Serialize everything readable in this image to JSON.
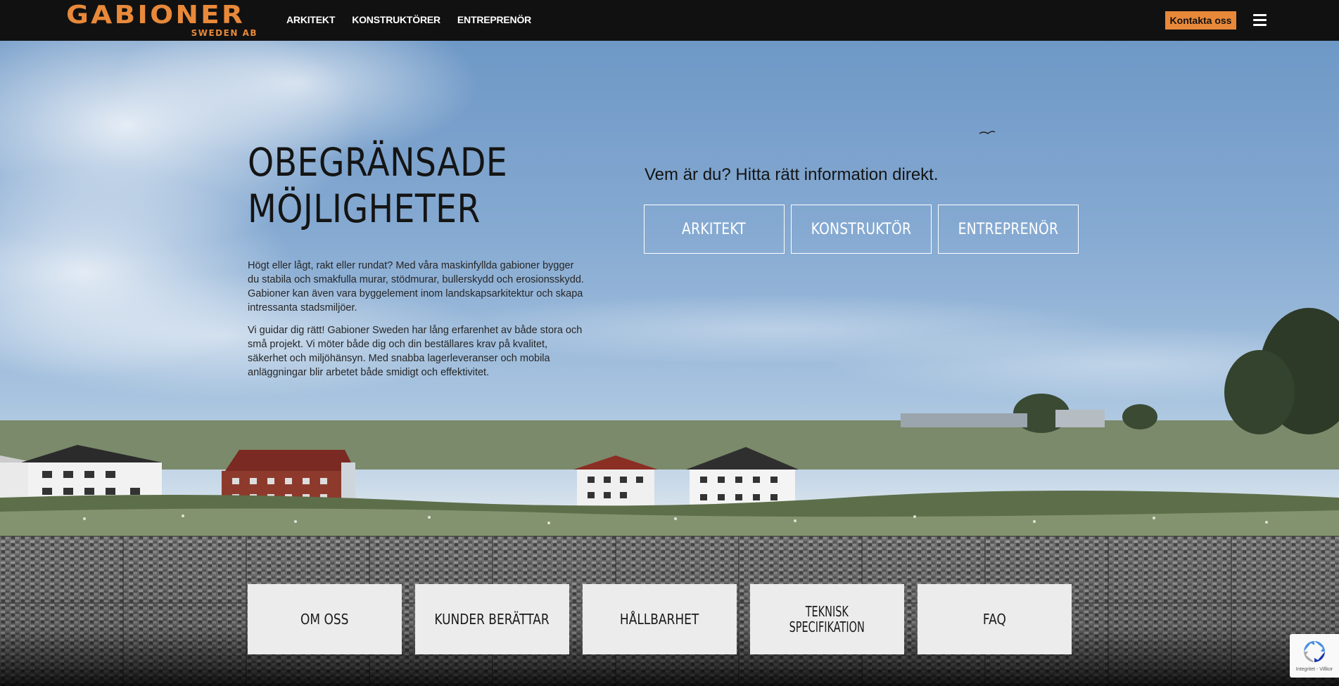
{
  "brand": {
    "name": "GABIONER",
    "sub": "SWEDEN AB",
    "accent": "#e8893a"
  },
  "nav": {
    "links": [
      "ARKITEKT",
      "KONSTRUKTÖRER",
      "ENTREPRENÖR"
    ],
    "contact": "Kontakta oss",
    "menu_icon": "hamburger-icon"
  },
  "hero": {
    "headline_line1": "OBEGRÄNSADE",
    "headline_line2": "MÖJLIGHETER",
    "paragraph1": "Högt eller lågt, rakt eller rundat? Med våra maskinfyllda gabioner bygger du stabila och smakfulla murar, stödmurar, bullerskydd och erosionsskydd. Gabioner kan även vara byggelement inom landskapsarkitektur och skapa intressanta stadsmiljöer.",
    "paragraph2": "Vi guidar dig rätt! Gabioner Sweden har lång erfarenhet av både stora och små projekt. Vi möter både dig och din beställares krav på kvalitet, säkerhet och miljöhänsyn. Med snabba lagerleveranser och mobila anläggningar blir arbetet både smidigt och effektivitet.",
    "who_prompt": "Vem är du? Hitta rätt information direkt.",
    "roles": [
      "ARKITEKT",
      "KONSTRUKTÖR",
      "ENTREPRENÖR"
    ]
  },
  "tiles": [
    {
      "label": "OM OSS"
    },
    {
      "label": "KUNDER BERÄTTAR"
    },
    {
      "label": "HÅLLBARHET"
    },
    {
      "label_line1": "TEKNISK",
      "label_line2": "SPECIFIKATION"
    },
    {
      "label": "FAQ"
    }
  ],
  "recaptcha": {
    "text": "Integritet - Villkor"
  }
}
